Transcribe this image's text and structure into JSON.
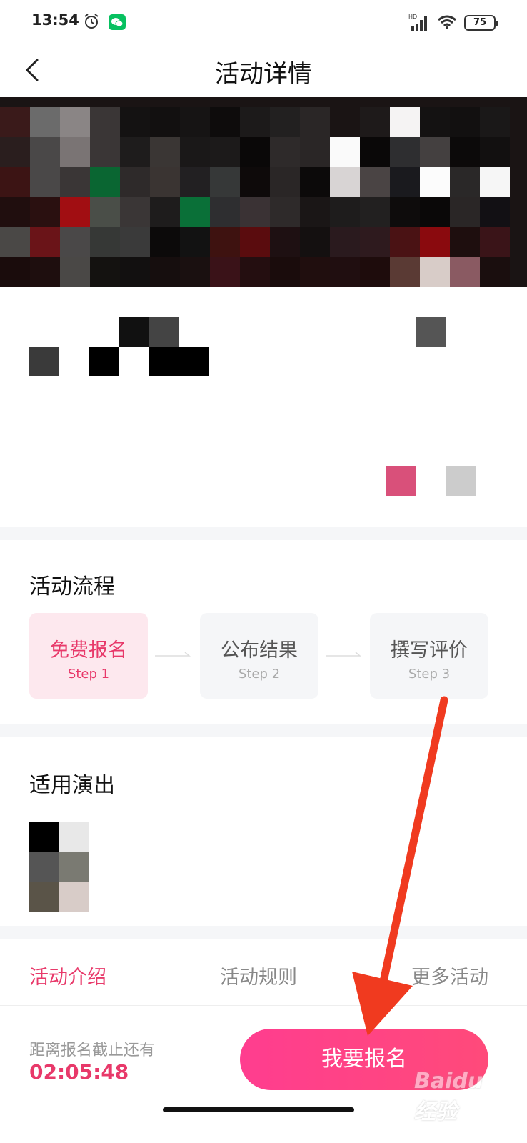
{
  "status_bar": {
    "time": "13:54",
    "network_badge": "HD",
    "battery": "75"
  },
  "nav": {
    "title": "活动详情"
  },
  "process": {
    "title": "活动流程",
    "steps": [
      {
        "name": "免费报名",
        "step": "Step 1"
      },
      {
        "name": "公布结果",
        "step": "Step 2"
      },
      {
        "name": "撰写评价",
        "step": "Step 3"
      }
    ]
  },
  "performance": {
    "title": "适用演出"
  },
  "tabs": [
    "活动介绍",
    "活动规则",
    "更多活动"
  ],
  "bottom": {
    "deadline_label": "距离报名截止还有",
    "deadline_time": "02:05:48",
    "signup_label": "我要报名"
  },
  "watermark": "Baidu 经验",
  "colors": {
    "accent": "#e8396a",
    "annotation_arrow": "#f03a1f"
  }
}
